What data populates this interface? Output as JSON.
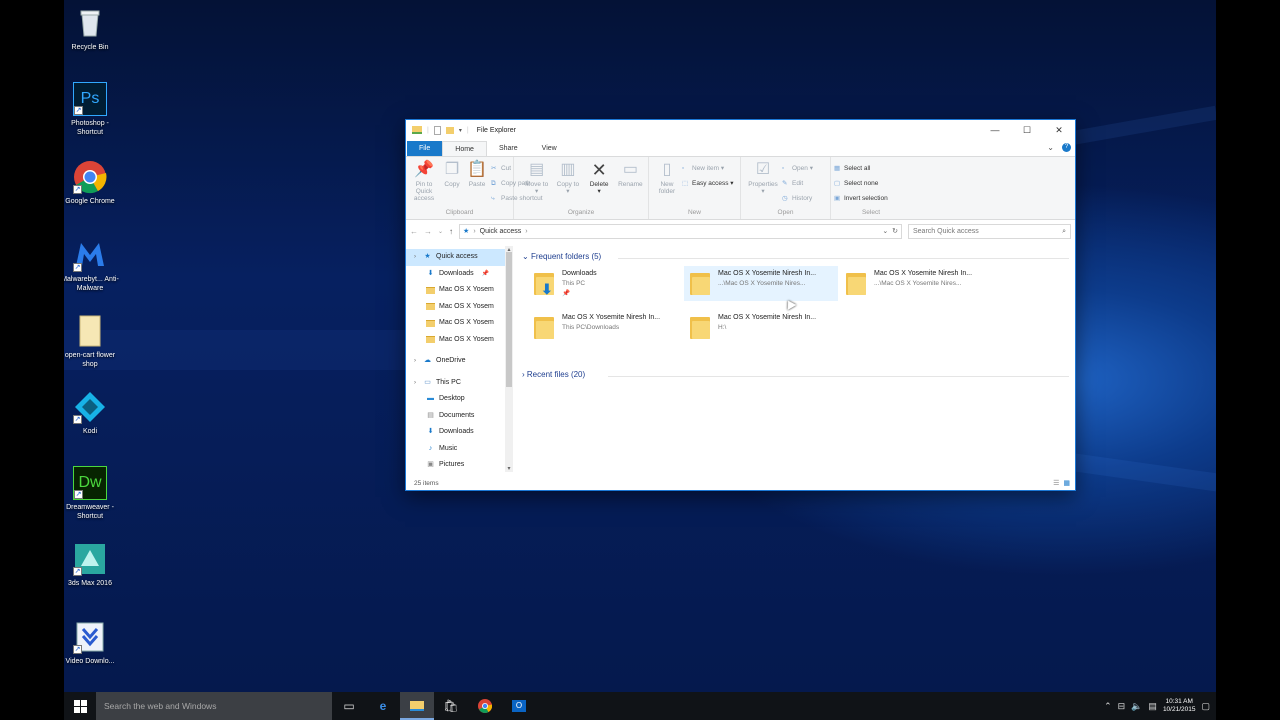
{
  "desktop": {
    "icons": [
      {
        "label": "Recycle Bin",
        "icon": "recycle-bin-icon"
      },
      {
        "label": "Photoshop - Shortcut",
        "icon": "photoshop-icon",
        "glyph": "Ps"
      },
      {
        "label": "Google Chrome",
        "icon": "chrome-icon"
      },
      {
        "label": "Malwarebyt... Anti-Malware",
        "icon": "malwarebytes-icon"
      },
      {
        "label": "open-cart flower shop",
        "icon": "file-icon"
      },
      {
        "label": "Kodi",
        "icon": "kodi-icon"
      },
      {
        "label": "Dreamweaver - Shortcut",
        "icon": "dreamweaver-icon",
        "glyph": "Dw"
      },
      {
        "label": "3ds Max 2016",
        "icon": "3dsmax-icon"
      },
      {
        "label": "Video Downlo...",
        "icon": "video-downloader-icon"
      }
    ]
  },
  "explorer": {
    "title": "File Explorer",
    "tabs": [
      "File",
      "Home",
      "Share",
      "View"
    ],
    "ribbon": {
      "clipboard": {
        "caption": "Clipboard",
        "pin": "Pin to Quick access",
        "copy": "Copy",
        "paste": "Paste",
        "cut": "Cut",
        "copy_path": "Copy path",
        "paste_shortcut": "Paste shortcut"
      },
      "organize": {
        "caption": "Organize",
        "move_to": "Move to",
        "copy_to": "Copy to",
        "delete": "Delete",
        "rename": "Rename"
      },
      "new": {
        "caption": "New",
        "new_folder": "New folder",
        "new_item": "New item",
        "easy_access": "Easy access"
      },
      "open": {
        "caption": "Open",
        "properties": "Properties",
        "open": "Open",
        "edit": "Edit",
        "history": "History"
      },
      "select": {
        "caption": "Select",
        "select_all": "Select all",
        "select_none": "Select none",
        "invert": "Invert selection"
      }
    },
    "address": {
      "path": "Quick access",
      "search_placeholder": "Search Quick access"
    },
    "nav": [
      {
        "label": "Quick access",
        "kind": "quick",
        "indent": 1
      },
      {
        "label": "Downloads",
        "kind": "download",
        "indent": 2
      },
      {
        "label": "Mac OS X Yosem",
        "kind": "folder",
        "indent": 2
      },
      {
        "label": "Mac OS X Yosem",
        "kind": "folder",
        "indent": 2
      },
      {
        "label": "Mac OS X Yosem",
        "kind": "folder",
        "indent": 2
      },
      {
        "label": "Mac OS X Yosem",
        "kind": "folder",
        "indent": 2
      },
      {
        "label": "OneDrive",
        "kind": "cloud",
        "indent": 1
      },
      {
        "label": "This PC",
        "kind": "pc",
        "indent": 1
      },
      {
        "label": "Desktop",
        "kind": "desktop",
        "indent": 2
      },
      {
        "label": "Documents",
        "kind": "docs",
        "indent": 2
      },
      {
        "label": "Downloads",
        "kind": "download",
        "indent": 2
      },
      {
        "label": "Music",
        "kind": "music",
        "indent": 2
      },
      {
        "label": "Pictures",
        "kind": "pictures",
        "indent": 2
      }
    ],
    "frequent": {
      "title": "Frequent folders",
      "count": "(5)",
      "items": [
        {
          "name": "Downloads",
          "path": "This PC",
          "pinned": true,
          "kind": "download"
        },
        {
          "name": "Mac OS X Yosemite Niresh In...",
          "path": "...\\Mac OS X Yosemite Nires...",
          "kind": "folder",
          "highlight": true
        },
        {
          "name": "Mac OS X Yosemite Niresh In...",
          "path": "...\\Mac OS X Yosemite Nires...",
          "kind": "folder"
        },
        {
          "name": "Mac OS X Yosemite Niresh In...",
          "path": "This PC\\Downloads",
          "kind": "folder"
        },
        {
          "name": "Mac OS X Yosemite Niresh In...",
          "path": "H:\\",
          "kind": "folder"
        }
      ]
    },
    "recent": {
      "title": "Recent files",
      "count": "(20)"
    },
    "status": "25 items"
  },
  "taskbar": {
    "search_placeholder": "Search the web and Windows",
    "time": "10:31 AM",
    "date": "10/21/2015",
    "apps": [
      "task-view-icon",
      "edge-icon",
      "file-explorer-icon",
      "store-icon",
      "chrome-icon",
      "outlook-icon"
    ]
  },
  "colors": {
    "accent": "#1979ca",
    "selection": "#cce8ff",
    "hover": "#e5f3ff",
    "folder": "#f3ce6c"
  }
}
